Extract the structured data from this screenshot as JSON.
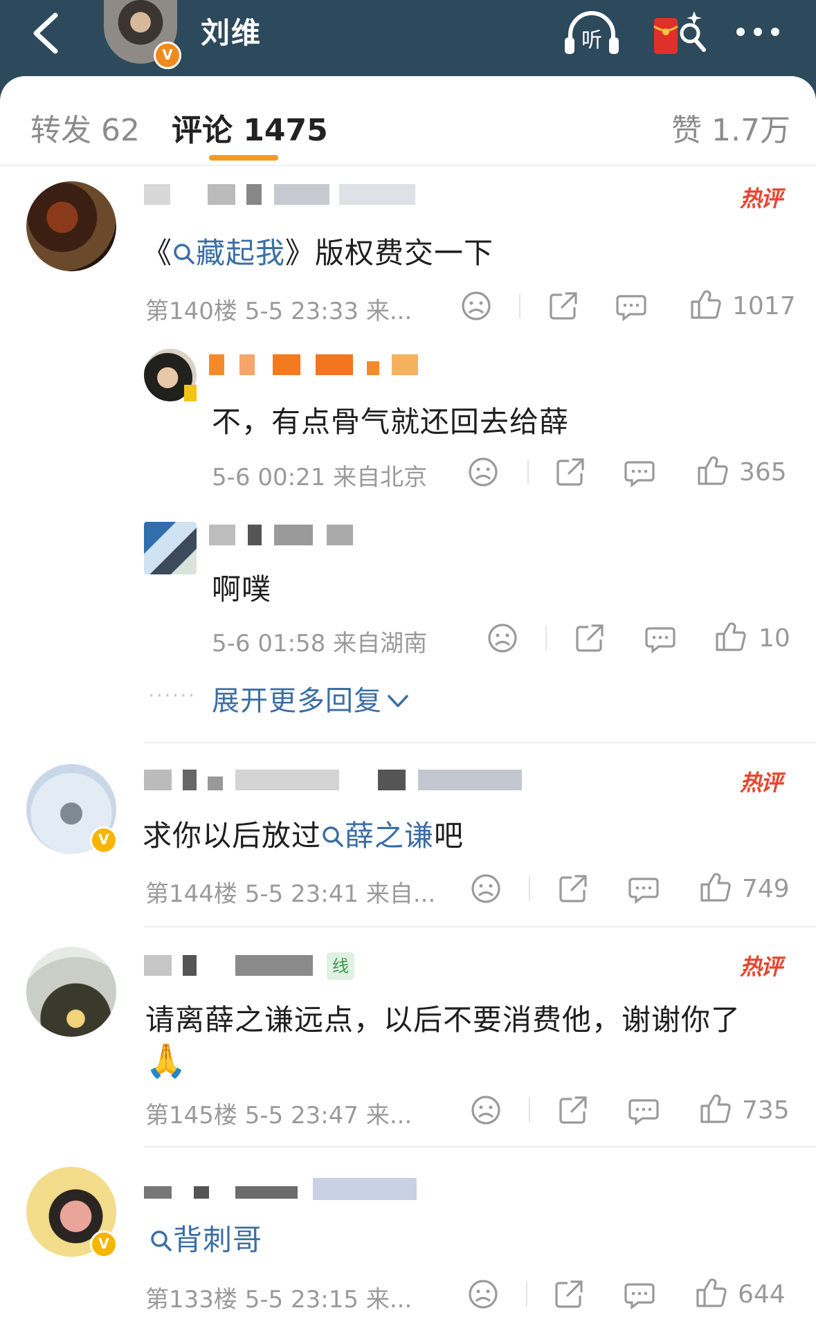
{
  "header": {
    "title": "刘维",
    "verified_badge": "V",
    "icons": [
      "back-icon",
      "listen-icon",
      "red-packet-icon",
      "more-icon"
    ],
    "listen_label": "听",
    "bg_color": "#2d4a5c"
  },
  "tabs": [
    {
      "label": "转发 62",
      "active": false
    },
    {
      "label": "评论 1475",
      "active": true
    },
    {
      "label": "赞 1.7万",
      "active": false
    }
  ],
  "accent_color": "#f59a21",
  "hot_label": "热评",
  "comments": [
    {
      "hot": true,
      "text_prefix": "《",
      "topic": "藏起我",
      "text_suffix": "》版权费交一下",
      "meta": "第140楼 5-5 23:33 来...",
      "likes": "1017",
      "replies": [
        {
          "text": "不，有点骨气就还回去给薛",
          "meta": "5-6 00:21 来自北京",
          "likes": "365"
        },
        {
          "text": "啊噗",
          "meta": "5-6 01:58 来自湖南",
          "likes": "10"
        }
      ],
      "expand_label": "展开更多回复"
    },
    {
      "hot": true,
      "text_prefix": "求你以后放过",
      "topic": "薛之谦",
      "text_suffix": "吧",
      "meta": "第144楼 5-5 23:41 来自...",
      "likes": "749"
    },
    {
      "hot": true,
      "tag": "线",
      "text": "请离薛之谦远点，以后不要消费他，谢谢你了",
      "emoji": "🙏",
      "meta": "第145楼 5-5 23:47 来...",
      "likes": "735"
    },
    {
      "hot": false,
      "topic": "背刺哥",
      "meta": "第133楼 5-5 23:15 来...",
      "likes": "644"
    }
  ]
}
